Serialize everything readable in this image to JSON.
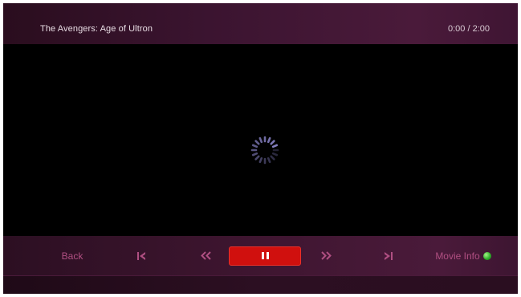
{
  "header": {
    "title": "The Avengers: Age of Ultron",
    "time": "0:00 / 2:00"
  },
  "player": {
    "state": "loading",
    "spinner_icon": "loading-spinner-icon"
  },
  "controls": {
    "back_label": "Back",
    "skip_back_icon": "skip-to-start-icon",
    "rewind_icon": "rewind-icon",
    "pause_icon": "pause-icon",
    "ffwd_icon": "fast-forward-icon",
    "skip_fwd_icon": "skip-to-end-icon",
    "movie_info_label": "Movie Info",
    "movie_info_indicator_icon": "green-dot-icon"
  },
  "colors": {
    "accent": "#b04f82",
    "pause_button": "#d0100e",
    "header_bg": "#3b1430",
    "indicator": "#2fb02a"
  }
}
